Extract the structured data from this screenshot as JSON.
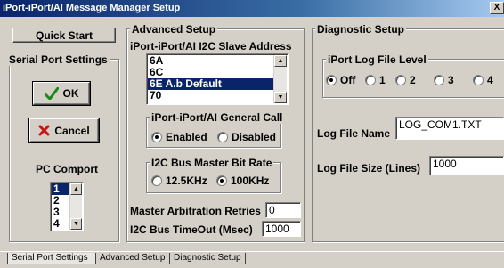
{
  "window": {
    "title": "iPort-iPort/AI Message Manager Setup",
    "close_glyph": "X"
  },
  "left": {
    "quick_start_label": "Quick Start",
    "serial_group_label": "Serial Port Settings",
    "ok_label": "OK",
    "cancel_label": "Cancel",
    "pc_comport_label": "PC Comport",
    "comports": [
      "1",
      "2",
      "3",
      "4"
    ],
    "selected_comport": "1"
  },
  "advanced": {
    "group_label": "Advanced Setup",
    "slave_address_label": "iPort-iPort/AI I2C Slave Address",
    "addresses": [
      "6A",
      "6C",
      "6E A.b Default",
      "70"
    ],
    "selected_address": "6E A.b Default",
    "general_call_label": "iPort-iPort/AI General Call",
    "general_call_options": [
      "Enabled",
      "Disabled"
    ],
    "general_call_selected": "Enabled",
    "bitrate_label": "I2C Bus Master Bit Rate",
    "bitrate_options": [
      "12.5KHz",
      "100KHz"
    ],
    "bitrate_selected": "100KHz",
    "arbitration_label": "Master Arbitration Retries",
    "arbitration_value": "0",
    "timeout_label": "I2C Bus TimeOut (Msec)",
    "timeout_value": "1000"
  },
  "diagnostic": {
    "group_label": "Diagnostic Setup",
    "log_level_label": "iPort Log File Level",
    "log_levels": [
      "Off",
      "1",
      "2",
      "3",
      "4"
    ],
    "log_level_selected": "Off",
    "log_file_name_label": "Log File Name",
    "log_file_name_value": "LOG_COM1.TXT",
    "log_file_size_label": "Log File Size (Lines)",
    "log_file_size_value": "1000"
  },
  "tabs": [
    {
      "label": "Serial Port Settings"
    },
    {
      "label": "Advanced Setup"
    },
    {
      "label": "Diagnostic Setup"
    }
  ]
}
